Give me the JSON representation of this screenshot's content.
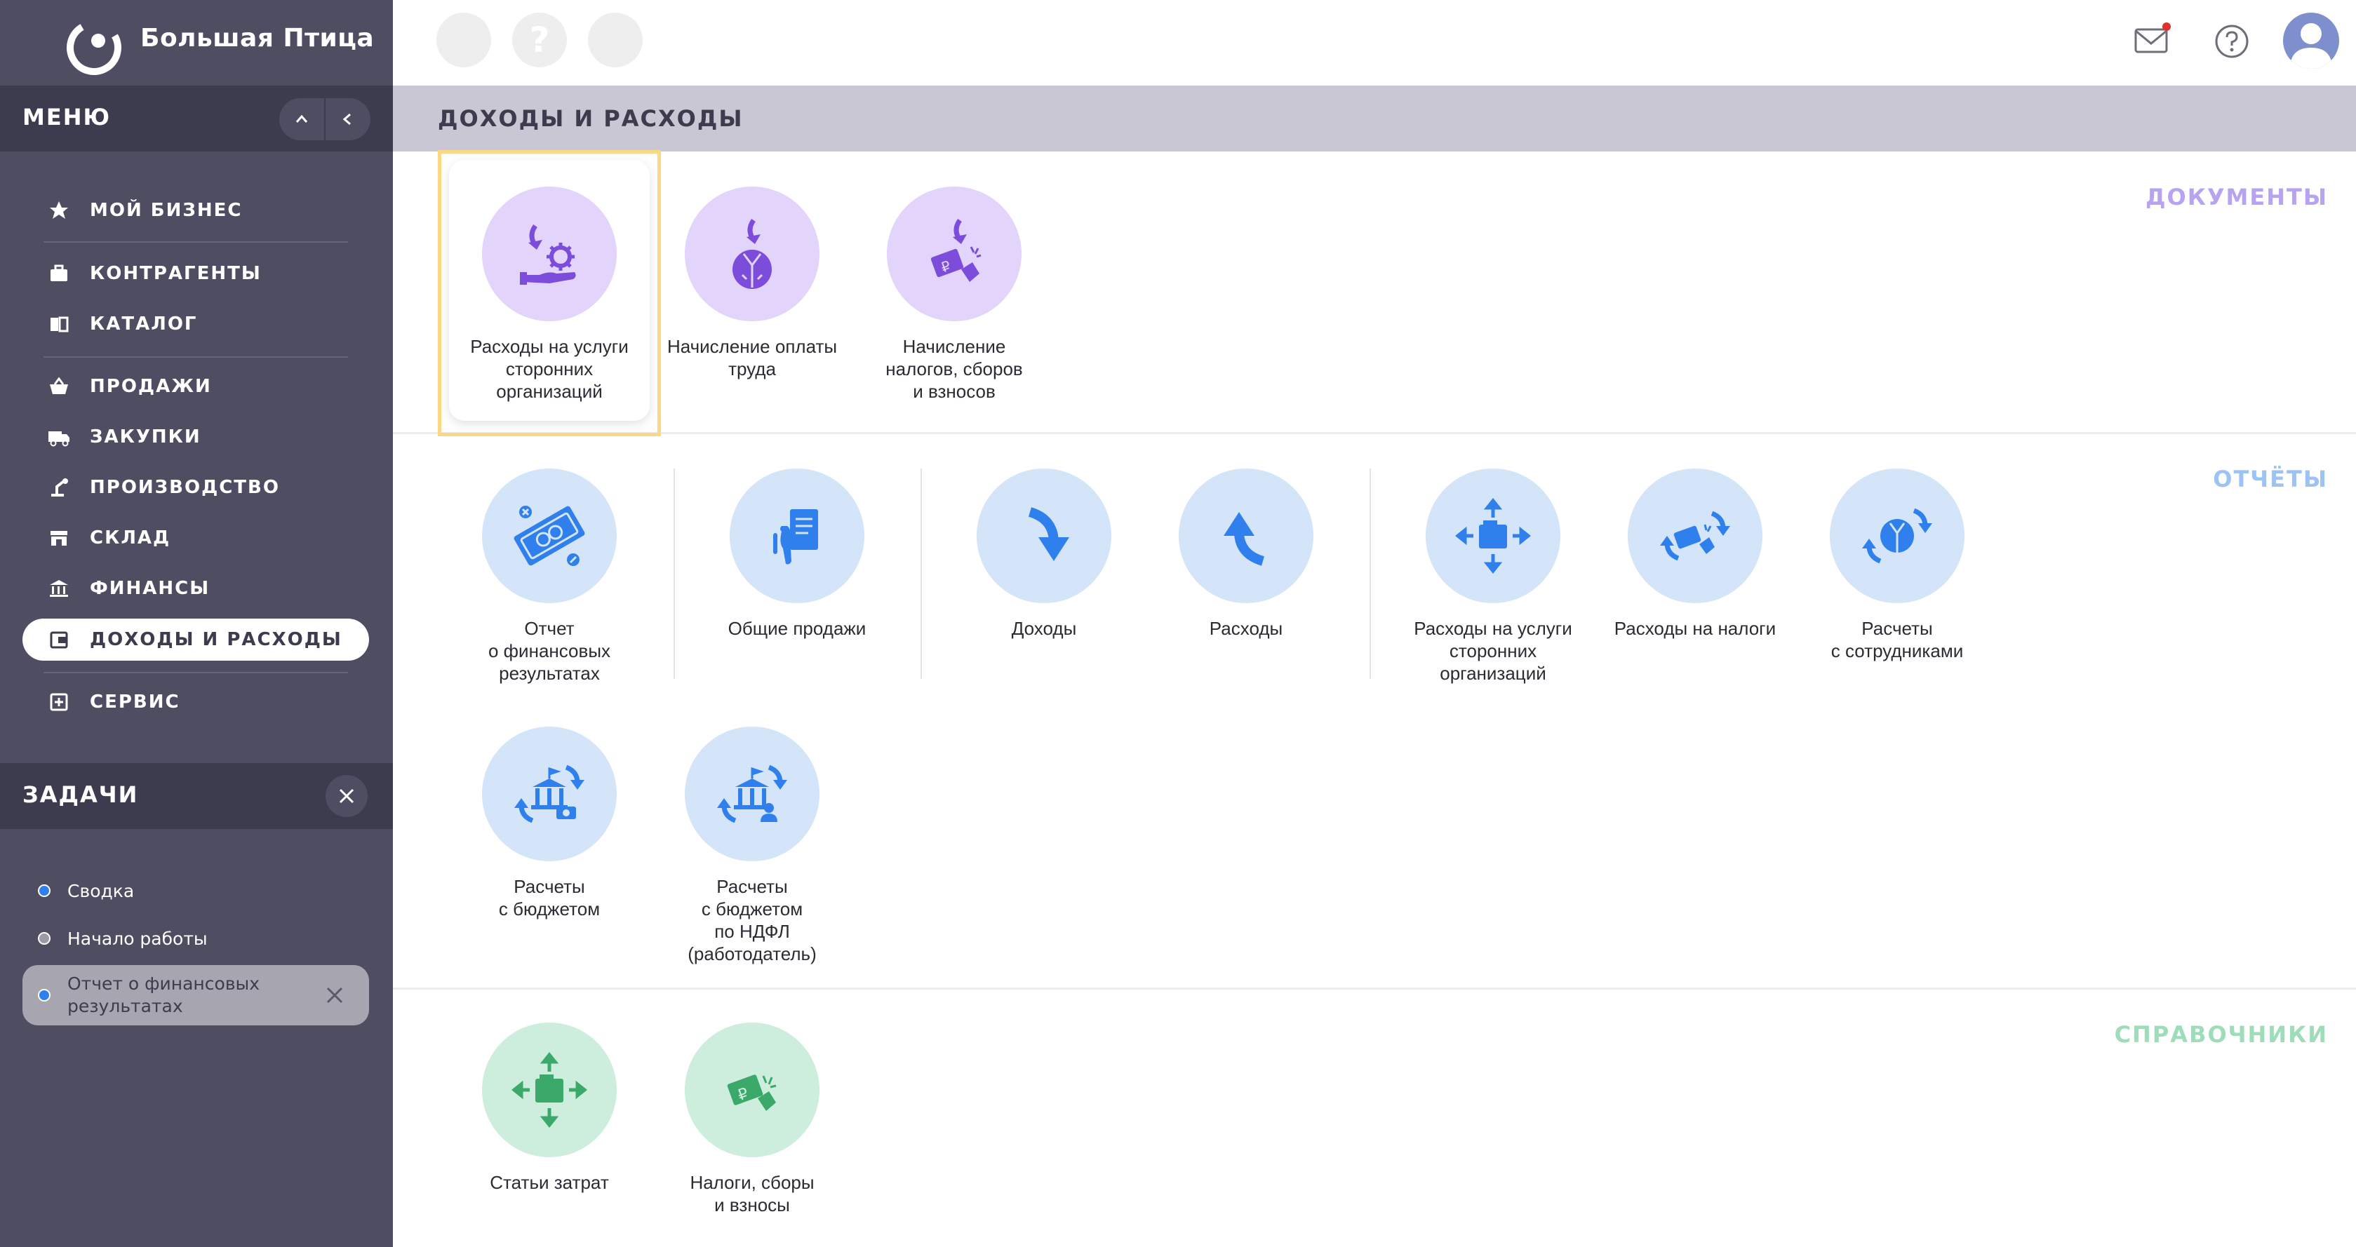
{
  "app": {
    "title": "Большая Птица"
  },
  "menu": {
    "title": "МЕНЮ",
    "items": [
      {
        "label": "МОЙ БИЗНЕС",
        "icon": "star-icon"
      },
      {
        "label": "КОНТРАГЕНТЫ",
        "icon": "briefcase-icon"
      },
      {
        "label": "КАТАЛОГ",
        "icon": "book-icon"
      },
      {
        "label": "ПРОДАЖИ",
        "icon": "basket-icon"
      },
      {
        "label": "ЗАКУПКИ",
        "icon": "truck-icon"
      },
      {
        "label": "ПРОИЗВОДСТВО",
        "icon": "robot-arm-icon"
      },
      {
        "label": "СКЛАД",
        "icon": "store-icon"
      },
      {
        "label": "ФИНАНСЫ",
        "icon": "bank-icon"
      },
      {
        "label": "ДОХОДЫ И РАСХОДЫ",
        "icon": "wallet-icon"
      },
      {
        "label": "СЕРВИС",
        "icon": "service-icon"
      }
    ]
  },
  "tasks": {
    "title": "ЗАДАЧИ",
    "items": [
      {
        "label": "Сводка",
        "dot": "#2f80ed"
      },
      {
        "label": "Начало работы",
        "dot": "#9b9aa5"
      },
      {
        "label": "Отчет о финансовых\nрезультатах",
        "dot": "#2f80ed"
      }
    ]
  },
  "page": {
    "title": "ДОХОДЫ И РАСХОДЫ"
  },
  "sections": {
    "documents": {
      "label": "ДОКУМЕНТЫ",
      "tiles": [
        {
          "label": "Расходы на услуги\nсторонних\nорганизаций"
        },
        {
          "label": "Начисление оплаты\nтруда"
        },
        {
          "label": "Начисление\nналогов, сборов\nи взносов"
        }
      ]
    },
    "reports": {
      "label": "ОТЧЁТЫ",
      "tiles": [
        {
          "label": "Отчет\nо финансовых\nрезультатах"
        },
        {
          "label": "Общие продажи"
        },
        {
          "label": "Доходы"
        },
        {
          "label": "Расходы"
        },
        {
          "label": "Расходы на услуги\nсторонних\nорганизаций"
        },
        {
          "label": "Расходы на налоги"
        },
        {
          "label": "Расчеты\nс сотрудниками"
        },
        {
          "label": "Расчеты\nс бюджетом"
        },
        {
          "label": "Расчеты\nс бюджетом\nпо НДФЛ\n(работодатель)"
        }
      ]
    },
    "references": {
      "label": "СПРАВОЧНИКИ",
      "tiles": [
        {
          "label": "Статьи затрат"
        },
        {
          "label": "Налоги, сборы\nи взносы"
        }
      ]
    }
  },
  "colors": {
    "purple": "#7c4ddb",
    "blue": "#2f80ed",
    "green": "#3aa96a",
    "documents_label": "#b7a3f0",
    "reports_label": "#9cc3f3",
    "references_label": "#9fdcb9"
  }
}
